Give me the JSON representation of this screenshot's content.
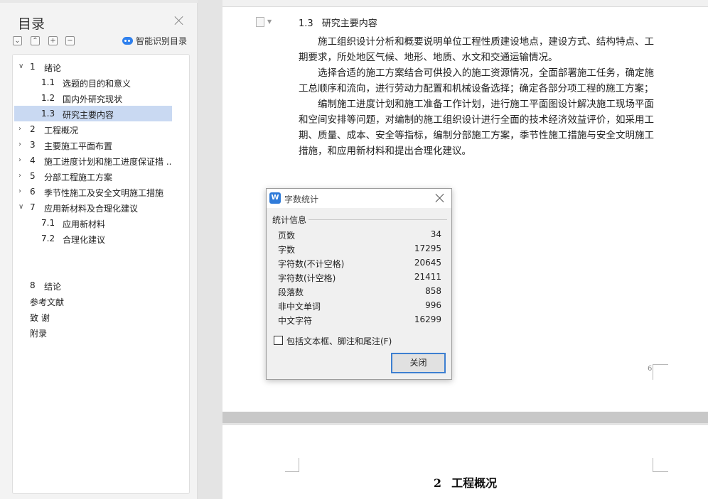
{
  "nav": {
    "title": "目录",
    "smart_toc_label": "智能识别目录",
    "toolbar": [
      "expand-all",
      "collapse-all",
      "add-item",
      "remove-item"
    ],
    "items": [
      {
        "num": "1",
        "label": "绪论",
        "level": 1,
        "arrow": "∨"
      },
      {
        "num": "1.1",
        "label": "选题的目的和意义",
        "level": 2
      },
      {
        "num": "1.2",
        "label": "国内外研究现状",
        "level": 2
      },
      {
        "num": "1.3",
        "label": "研究主要内容",
        "level": 2,
        "selected": true
      },
      {
        "num": "2",
        "label": "工程概况",
        "level": 1,
        "arrow": "›"
      },
      {
        "num": "3",
        "label": "主要施工平面布置",
        "level": 1,
        "arrow": "›"
      },
      {
        "num": "4",
        "label": "施工进度计划和施工进度保证措 ...",
        "level": 1,
        "arrow": "›"
      },
      {
        "num": "5",
        "label": "分部工程施工方案",
        "level": 1,
        "arrow": "›"
      },
      {
        "num": "6",
        "label": "季节性施工及安全文明施工措施",
        "level": 1,
        "arrow": "›"
      },
      {
        "num": "7",
        "label": "应用新材料及合理化建议",
        "level": 1,
        "arrow": "∨"
      },
      {
        "num": "7.1",
        "label": "应用新材料",
        "level": 2
      },
      {
        "num": "7.2",
        "label": "合理化建议",
        "level": 2
      },
      {
        "num": "8",
        "label": "结论",
        "level": 0
      },
      {
        "num": "",
        "label": "参考文献",
        "level": 0
      },
      {
        "num": "",
        "label": "致 谢",
        "level": 0
      },
      {
        "num": "",
        "label": "附录",
        "level": 0
      }
    ]
  },
  "document": {
    "section_heading": {
      "num": "1.3",
      "text": "研究主要内容"
    },
    "paragraphs": [
      "施工组织设计分析和概要说明单位工程性质建设地点，建设方式、结构特点、工期要求，所处地区气候、地形、地质、水文和交通运输情况。",
      "选择合适的施工方案结合可供投入的施工资源情况，全面部署施工任务，确定施工总顺序和流向，进行劳动力配置和机械设备选择；确定各部分项工程的施工方案；",
      "编制施工进度计划和施工准备工作计划，进行施工平面图设计解决施工现场平面和空间安排等问题，对编制的施工组织设计进行全面的技术经济效益评价，如采用工期、质量、成本、安全等指标，编制分部施工方案，季节性施工措施与安全文明施工措施，和应用新材料和提出合理化建议。"
    ],
    "page_number": "6",
    "next_chapter": {
      "num": "2",
      "text": "工程概况"
    }
  },
  "word_count_dialog": {
    "title": "字数统计",
    "app_icon": "W",
    "group_label": "统计信息",
    "stats": [
      {
        "label": "页数",
        "value": "34"
      },
      {
        "label": "字数",
        "value": "17295"
      },
      {
        "label": "字符数(不计空格)",
        "value": "20645"
      },
      {
        "label": "字符数(计空格)",
        "value": "21411"
      },
      {
        "label": "段落数",
        "value": "858"
      },
      {
        "label": "非中文单词",
        "value": "996"
      },
      {
        "label": "中文字符",
        "value": "16299"
      }
    ],
    "checkbox_label": "包括文本框、脚注和尾注(F)",
    "checkbox_checked": false,
    "close_button_label": "关闭"
  },
  "colors": {
    "accent": "#2f80ed",
    "selection": "#c9d9f2",
    "button_border": "#3d7fd1"
  }
}
